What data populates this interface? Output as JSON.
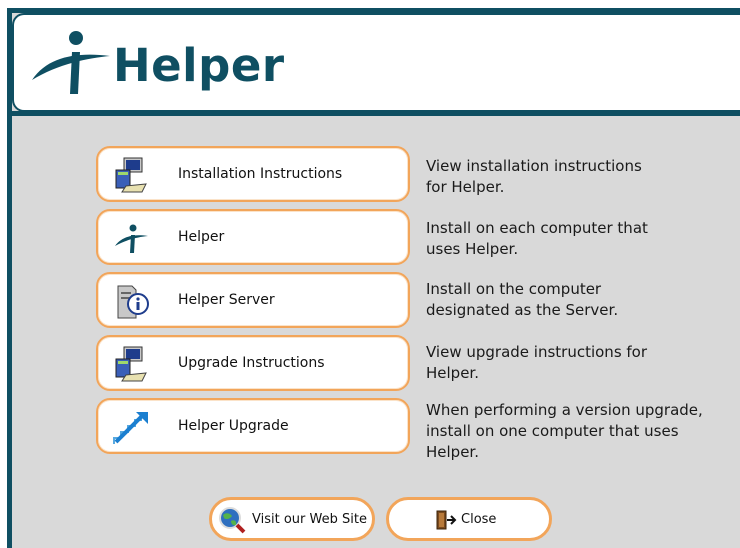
{
  "header": {
    "logo_text": "Helper",
    "brand_color": "#0f4f62",
    "accent_color": "#f2a55a"
  },
  "options": [
    {
      "label": "Installation Instructions",
      "icon": "installer-computer-icon",
      "description": [
        "View installation instructions",
        "for Helper."
      ]
    },
    {
      "label": "Helper",
      "icon": "helper-logo-icon",
      "description": [
        "Install on each computer that",
        "uses Helper."
      ]
    },
    {
      "label": "Helper Server",
      "icon": "server-info-icon",
      "description": [
        "Install on the computer",
        "designated as the Server."
      ]
    },
    {
      "label": "Upgrade Instructions",
      "icon": "installer-computer-icon",
      "description": [
        "View upgrade instructions for",
        "Helper."
      ]
    },
    {
      "label": "Helper Upgrade",
      "icon": "upgrade-stairs-icon",
      "description": [
        "When performing a version upgrade,",
        "install on one computer that uses",
        "Helper."
      ]
    }
  ],
  "footer": {
    "website_label": "Visit our Web Site",
    "website_icon": "globe-magnifier-icon",
    "close_label": "Close",
    "close_icon": "exit-door-icon"
  }
}
